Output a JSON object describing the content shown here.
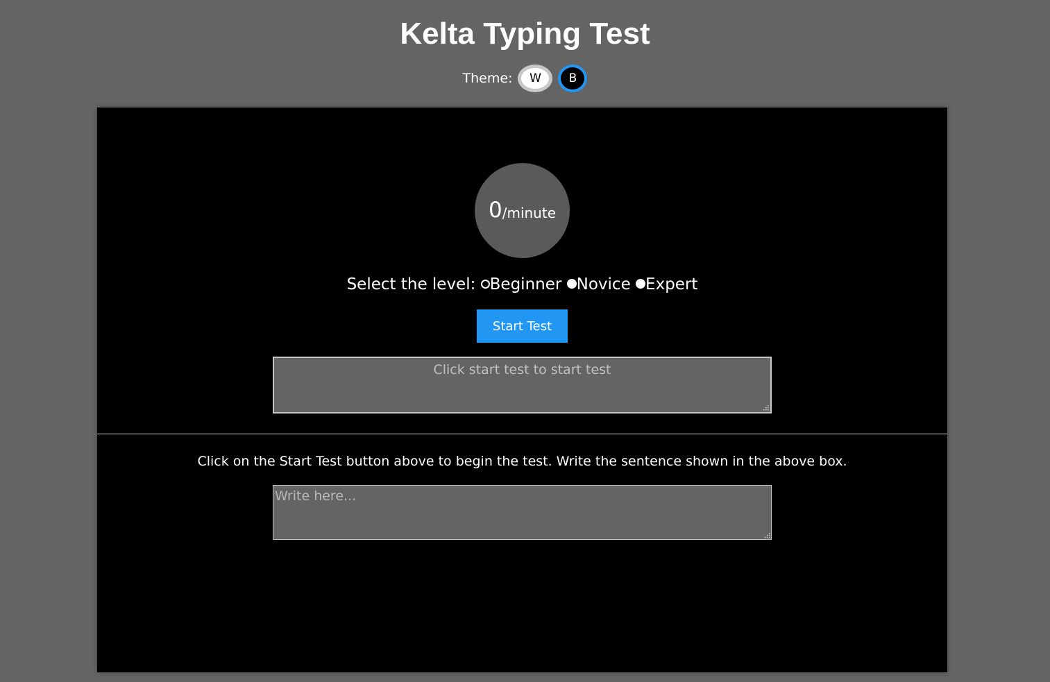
{
  "header": {
    "title": "Kelta Typing Test",
    "theme_label": "Theme:",
    "theme_white": "W",
    "theme_black": "B",
    "active_theme": "B"
  },
  "speed": {
    "value": "0",
    "unit": "/minute"
  },
  "level": {
    "label": "Select the level:",
    "options": [
      "Beginner",
      "Novice",
      "Expert"
    ],
    "selected": "Beginner"
  },
  "start_button": "Start Test",
  "sentence_box": {
    "text": "Click start test to start test"
  },
  "instructions": "Click on the Start Test button above to begin the test. Write the sentence shown in the above box.",
  "write_box": {
    "placeholder": "Write here...",
    "value": ""
  },
  "colors": {
    "page_background": "#646464",
    "panel_background": "#000000",
    "accent": "#2196f3",
    "speed_circle": "#5a5a5a"
  }
}
